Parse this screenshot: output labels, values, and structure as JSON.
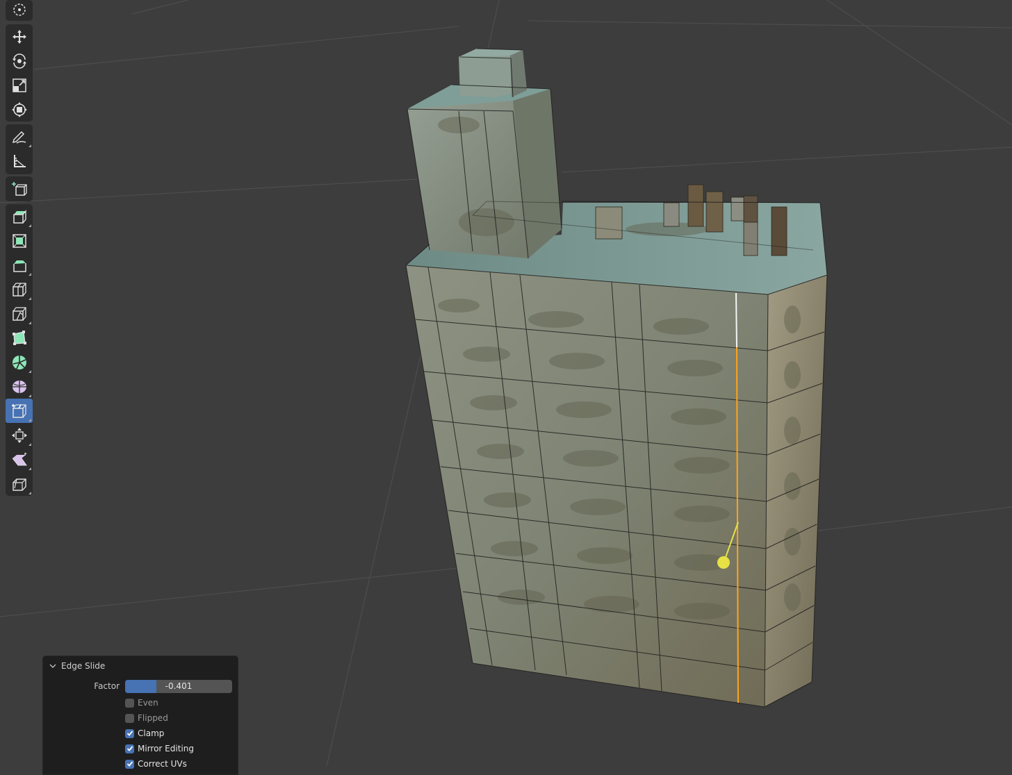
{
  "toolbar": {
    "tools": [
      {
        "name": "cursor-icon"
      },
      {
        "name": "move-icon"
      },
      {
        "name": "rotate-icon"
      },
      {
        "name": "scale-icon"
      },
      {
        "name": "transform-icon"
      },
      {
        "name": "annotate-icon"
      },
      {
        "name": "measure-icon"
      },
      {
        "name": "add-cube-icon"
      },
      {
        "name": "extrude-region-icon"
      },
      {
        "name": "inset-faces-icon"
      },
      {
        "name": "bevel-icon"
      },
      {
        "name": "loop-cut-icon"
      },
      {
        "name": "knife-icon"
      },
      {
        "name": "poly-build-icon"
      },
      {
        "name": "spin-icon"
      },
      {
        "name": "smooth-icon"
      },
      {
        "name": "edge-slide-icon",
        "active": true
      },
      {
        "name": "shrink-fatten-icon"
      },
      {
        "name": "shear-icon"
      },
      {
        "name": "rip-region-icon"
      }
    ]
  },
  "operator_panel": {
    "title": "Edge Slide",
    "factor_label": "Factor",
    "factor_value": "-0.401",
    "factor_fraction": 0.29,
    "options": [
      {
        "label": "Even",
        "checked": false
      },
      {
        "label": "Flipped",
        "checked": false
      },
      {
        "label": "Clamp",
        "checked": true
      },
      {
        "label": "Mirror Editing",
        "checked": true
      },
      {
        "label": "Correct UVs",
        "checked": true
      }
    ]
  },
  "colors": {
    "background": "#3d3d3d",
    "accent": "#4772b3",
    "active_edge": "#ffa41c",
    "gizmo": "#e6e145",
    "building_wall": "#8f9380",
    "building_roof": "#7d9991"
  }
}
